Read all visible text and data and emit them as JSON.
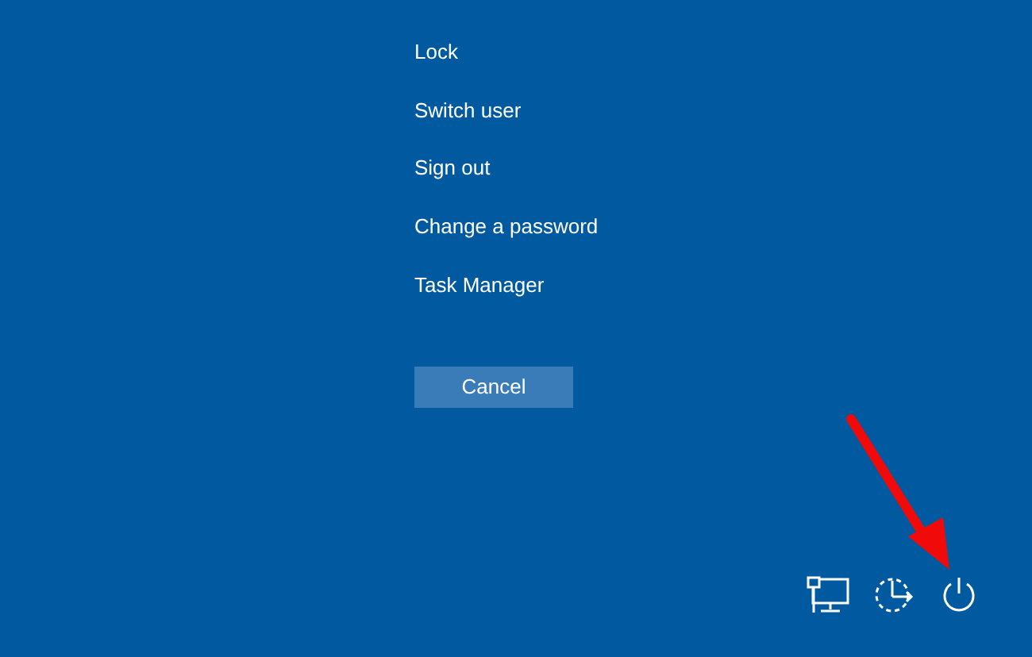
{
  "menu": [
    {
      "label": "Lock"
    },
    {
      "label": "Switch user"
    },
    {
      "label": "Sign out"
    },
    {
      "label": "Change a password"
    },
    {
      "label": "Task Manager"
    }
  ],
  "cancel_button": {
    "label": "Cancel"
  }
}
